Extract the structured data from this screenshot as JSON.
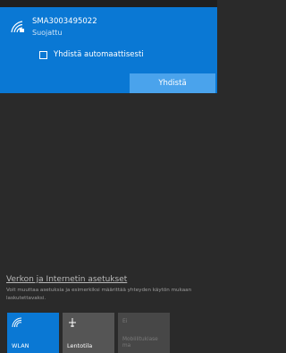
{
  "network": {
    "name": "SMA3003495022",
    "status": "Suojattu",
    "auto_connect_label": "Yhdistä automaattisesti",
    "connect_label": "Yhdistä"
  },
  "settings": {
    "link": "Verkon ja Internetin asetukset",
    "description": "Voit muuttaa asetuksia ja esimerkiksi määrittää yhteyden käytön mukaan laskutettavaksi."
  },
  "tiles": {
    "wlan": {
      "label": "WLAN",
      "icon": "wifi-icon"
    },
    "flight": {
      "label": "Lentotila",
      "icon": "airplane-icon"
    },
    "hotspot": {
      "top": "Ei",
      "label": "Mobiilitukiase ma",
      "icon": "hotspot-icon"
    }
  },
  "colors": {
    "accent": "#0a78d4",
    "background": "#2a2a2a"
  }
}
